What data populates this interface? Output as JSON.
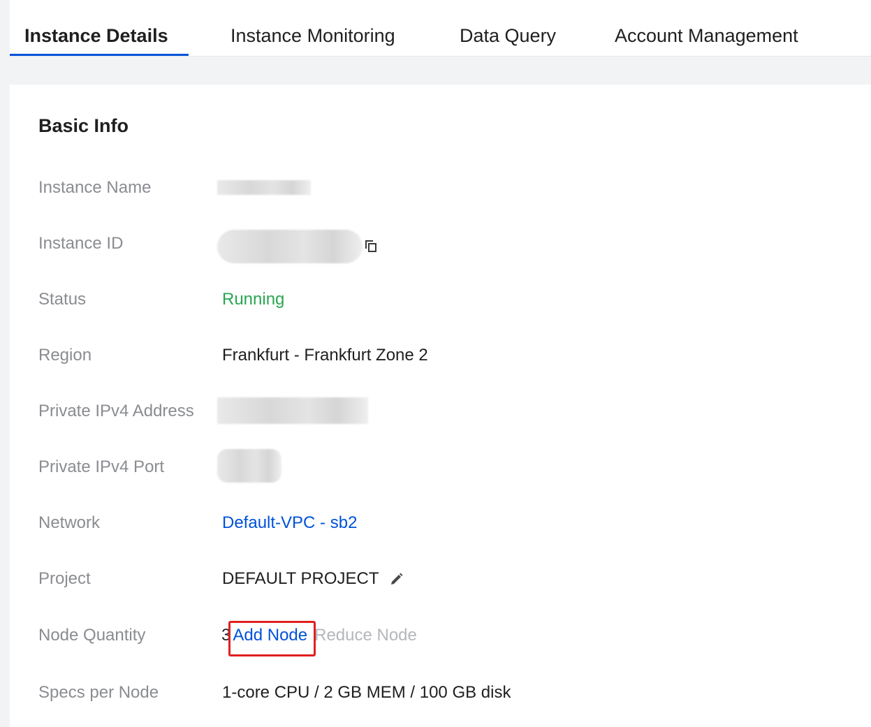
{
  "tabs": [
    {
      "label": "Instance Details",
      "active": true
    },
    {
      "label": "Instance Monitoring",
      "active": false
    },
    {
      "label": "Data Query",
      "active": false
    },
    {
      "label": "Account Management",
      "active": false
    }
  ],
  "basic_info": {
    "title": "Basic Info",
    "instance_name_label": "Instance Name",
    "instance_id_label": "Instance ID",
    "status_label": "Status",
    "status_value": "Running",
    "region_label": "Region",
    "region_value": "Frankfurt - Frankfurt Zone 2",
    "private_ipv4_address_label": "Private IPv4 Address",
    "private_ipv4_port_label": "Private IPv4 Port",
    "network_label": "Network",
    "network_vpc": "Default-VPC",
    "network_separator": " - ",
    "network_subnet": "sb2",
    "project_label": "Project",
    "project_value": "DEFAULT PROJECT",
    "node_quantity_label": "Node Quantity",
    "node_quantity_value": "3",
    "add_node_label": "Add Node",
    "reduce_node_label": "Reduce Node",
    "specs_label": "Specs per Node",
    "specs_value": "1-core CPU / 2 GB MEM / 100 GB disk"
  },
  "icons": {
    "copy": "copy-icon",
    "edit": "pencil-icon"
  },
  "colors": {
    "accent": "#0052d9",
    "status_running": "#29a651",
    "highlight": "#e02020"
  }
}
